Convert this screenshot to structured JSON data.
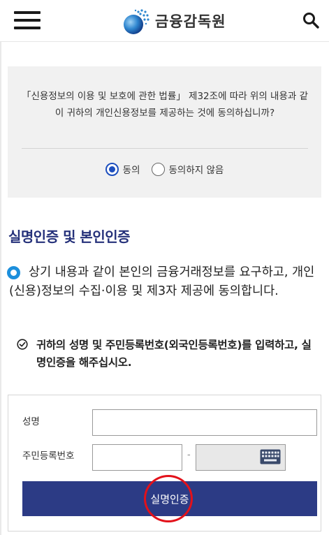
{
  "header": {
    "logo_text": "금융감독원",
    "menu_icon": "hamburger-menu-icon",
    "search_icon": "search-icon"
  },
  "consent": {
    "text": "「신용정보의 이용 및 보호에 관한 법률」 제32조에 따라 위의 내용과 같이 귀하의 개인신용정보를 제공하는 것에 동의하십니까?",
    "options": [
      {
        "label": "동의",
        "checked": true
      },
      {
        "label": "동의하지 않음",
        "checked": false
      }
    ]
  },
  "section": {
    "title": "실명인증 및 본인인증"
  },
  "agreement": {
    "text": "상기 내용과 같이 본인의 금융거래정보를 요구하고, 개인(신용)정보의 수집·이용 및 제3자 제공에 동의합니다."
  },
  "note": {
    "text": "귀하의 성명 및 주민등록번호(외국인등록번호)를 입력하고, 실명인증을 해주십시오."
  },
  "form": {
    "name_label": "성명",
    "name_value": "",
    "rrn_label": "주민등록번호",
    "rrn_front_value": "",
    "rrn_separator": "-",
    "rrn_back_value": "",
    "keyboard_icon": "keyboard-icon",
    "submit_label": "실명인증"
  },
  "colors": {
    "accent_navy": "#2c3b85",
    "title_navy": "#25317a",
    "radio_blue": "#1d4fbe",
    "bullet_blue": "#1c8fdc",
    "highlight_red": "#e3111a"
  }
}
